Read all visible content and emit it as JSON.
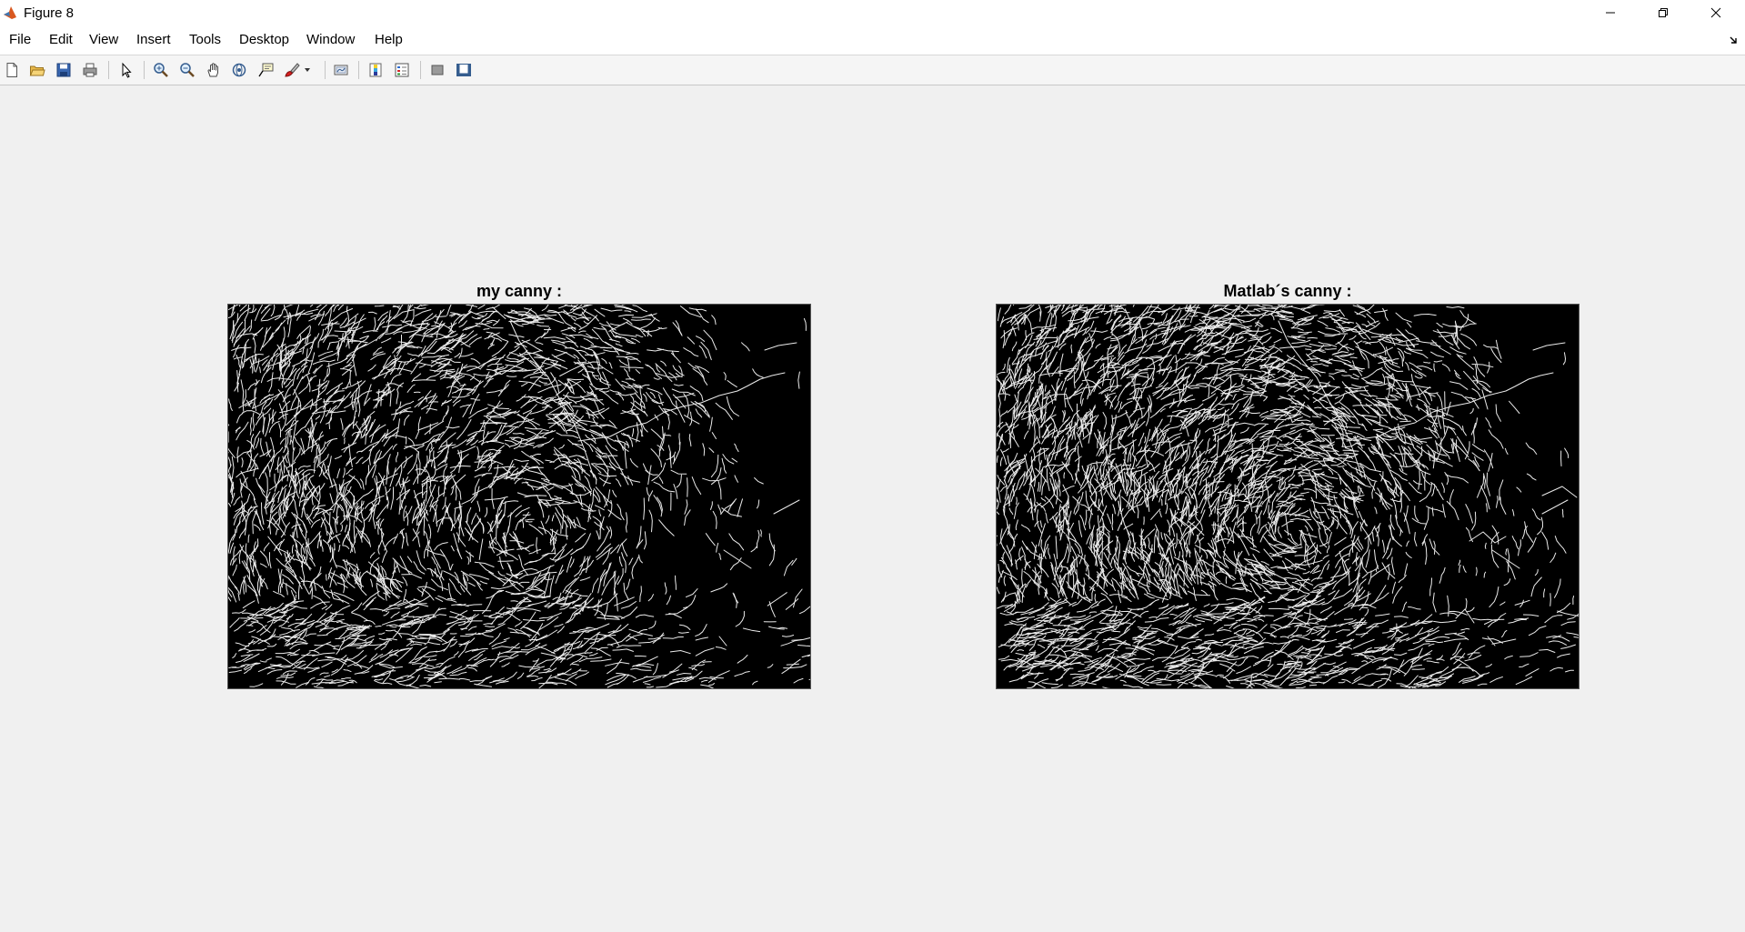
{
  "window": {
    "title": "Figure 8",
    "icon": "matlab-icon",
    "controls": [
      "minimize-icon",
      "restore-icon",
      "close-icon"
    ]
  },
  "menubar": {
    "items": [
      "File",
      "Edit",
      "View",
      "Insert",
      "Tools",
      "Desktop",
      "Window",
      "Help"
    ]
  },
  "toolbar": {
    "buttons": [
      "new-figure-icon",
      "open-file-icon",
      "save-icon",
      "print-icon",
      "edit-plot-arrow-icon",
      "zoom-in-icon",
      "zoom-out-icon",
      "pan-hand-icon",
      "rotate-3d-icon",
      "data-cursor-icon",
      "brush-icon",
      "link-plot-icon",
      "colorbar-icon",
      "legend-icon",
      "hide-plot-tools-icon",
      "show-plot-tools-icon"
    ]
  },
  "axes": [
    {
      "title": "my canny :",
      "image": "edge-map-wave-1"
    },
    {
      "title": "Matlab´s canny :",
      "image": "edge-map-wave-2"
    }
  ]
}
